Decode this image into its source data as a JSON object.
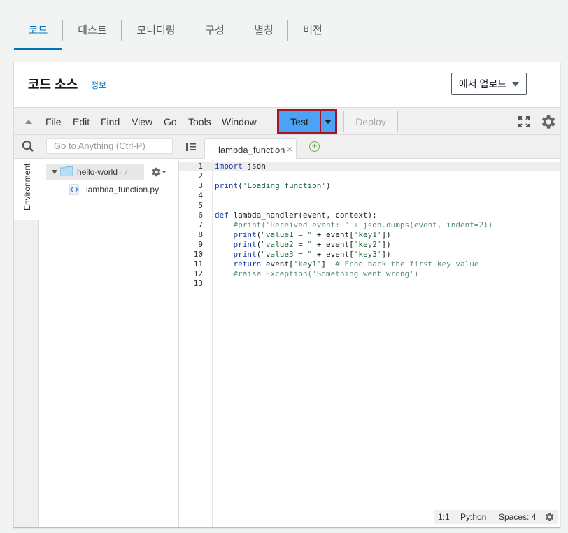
{
  "tabs": [
    "코드",
    "테스트",
    "모니터링",
    "구성",
    "별칭",
    "버전"
  ],
  "panel": {
    "title": "코드 소스",
    "info_link": "정보",
    "upload_label": "에서 업로드"
  },
  "menu": [
    "File",
    "Edit",
    "Find",
    "View",
    "Go",
    "Tools",
    "Window"
  ],
  "toolbar": {
    "test_label": "Test",
    "deploy_label": "Deploy"
  },
  "search": {
    "placeholder": "Go to Anything (Ctrl-P)"
  },
  "sidebar": {
    "env_label": "Environment",
    "folder_name": "hello-world",
    "folder_path": " - /",
    "file_name": "lambda_function.py"
  },
  "editor": {
    "tab_label": "lambda_function",
    "line_numbers": [
      "1",
      "2",
      "3",
      "4",
      "5",
      "6",
      "7",
      "8",
      "9",
      "10",
      "11",
      "12",
      "13"
    ],
    "code": [
      "import json",
      "",
      "print('Loading function')",
      "",
      "",
      "def lambda_handler(event, context):",
      "    #print(\"Received event: \" + json.dumps(event, indent=2))",
      "    print(\"value1 = \" + event['key1'])",
      "    print(\"value2 = \" + event['key2'])",
      "    print(\"value3 = \" + event['key3'])",
      "    return event['key1']  # Echo back the first key value",
      "    #raise Exception('Something went wrong')",
      ""
    ]
  },
  "status": {
    "position": "1:1",
    "language": "Python",
    "spaces": "Spaces: 4"
  },
  "colors": {
    "accent": "#0073bb",
    "test_button": "#4ca3f5",
    "highlight_border": "#a31621"
  }
}
